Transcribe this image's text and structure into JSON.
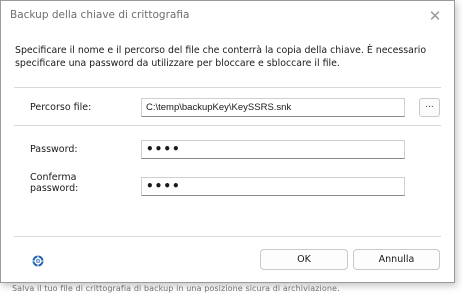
{
  "background_text": "Salva il tuo file di crittografia di backup in una posizione sicura di archiviazione.",
  "dialog": {
    "title": "Backup della chiave di crittografia",
    "close_glyph": "✕",
    "description": "Specificare il nome e il percorso del file che conterrà la copia della chiave. È necessario specificare una password da utilizzare per bloccare e sbloccare il file."
  },
  "form": {
    "path_label": "Percorso file:",
    "path_value": "C:\\temp\\backupKey\\KeySSRS.snk",
    "browse_label": "...",
    "password_label": "Password:",
    "password_value": "••••",
    "confirm_label_line1": "Conferma",
    "confirm_label_line2": "password:",
    "confirm_value": "••••"
  },
  "footer": {
    "help_icon": "help-icon",
    "ok_label": "OK",
    "cancel_label": "Annulla"
  },
  "colors": {
    "help_icon_blue": "#1e5fb0",
    "border": "#9a9a9a"
  }
}
